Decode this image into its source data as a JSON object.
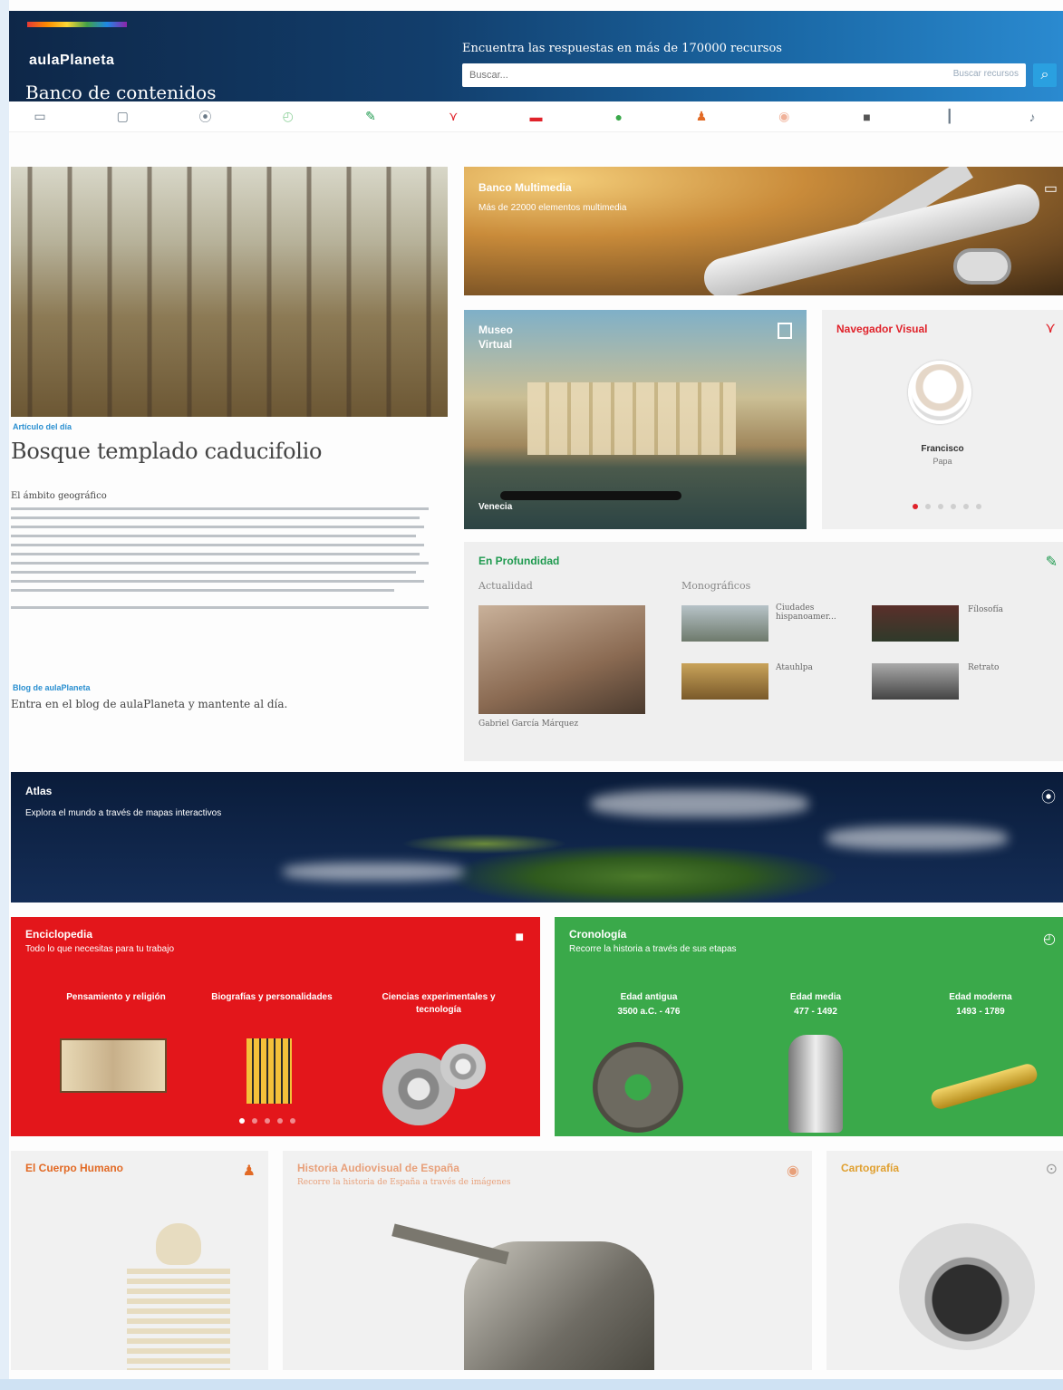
{
  "header": {
    "logo_name": "aulaPlaneta",
    "logo_sub": "Banco de contenidos",
    "search_caption": "Encuentra las respuestas en más de 170000 recursos",
    "search_placeholder": "Buscar...",
    "search_scope": "Buscar recursos",
    "search_icon": "magnifier"
  },
  "nav_icons": [
    "monitor-icon",
    "frame-icon",
    "pin-icon",
    "clock-icon",
    "pushpin-icon",
    "network-icon",
    "book-icon",
    "globe-icon",
    "person-icon",
    "eye-icon",
    "bag-icon",
    "chart-icon",
    "music-icon"
  ],
  "hero": {
    "tag": "Artículo del día",
    "title": "Bosque templado caducifolio",
    "subtitle": "El ámbito geográfico",
    "blog_tag": "Blog de aulaPlaneta",
    "blog_text": "Entra en el blog de aulaPlaneta y mantente al día."
  },
  "multimedia": {
    "title": "Banco Multimedia",
    "subtitle": "Más de 22000 elementos multimedia"
  },
  "museo": {
    "title": "Museo Virtual",
    "caption": "Venecia"
  },
  "navegador": {
    "title": "Navegador Visual",
    "person_name": "Francisco",
    "person_role": "Papa"
  },
  "profundidad": {
    "title": "En Profundidad",
    "col_left": "Actualidad",
    "col_right": "Monográficos",
    "caption": "Gabriel García Márquez",
    "items": [
      "Ciudades hispanoamer...",
      "Fílosofía",
      "Atauhlpa",
      "Retrato"
    ]
  },
  "atlas": {
    "title": "Atlas",
    "subtitle": "Explora el mundo a través de mapas interactivos"
  },
  "enciclopedia": {
    "title": "Enciclopedia",
    "subtitle": "Todo lo que necesitas para tu trabajo",
    "categories": [
      "Pensamiento y religión",
      "Biografías y personalidades",
      "Ciencias experimentales y tecnología"
    ]
  },
  "cronologia": {
    "title": "Cronología",
    "subtitle": "Recorre la historia a través de sus etapas",
    "periods": [
      {
        "name": "Edad antigua",
        "range": "3500 a.C. - 476"
      },
      {
        "name": "Edad media",
        "range": "477 - 1492"
      },
      {
        "name": "Edad moderna",
        "range": "1493 - 1789"
      }
    ]
  },
  "bottom": {
    "cuerpo_title": "El Cuerpo Humano",
    "historia_title": "Historia Audiovisual de España",
    "historia_sub": "Recorre la historia de España a través de imágenes",
    "carto_title": "Cartografía"
  },
  "colors": {
    "header": "#123e6c",
    "enciclopedia": "#e3161b",
    "cronologia": "#3aa94a",
    "accent_red": "#e0222a",
    "accent_green": "#1f9a4f",
    "accent_orange": "#e26a25"
  }
}
